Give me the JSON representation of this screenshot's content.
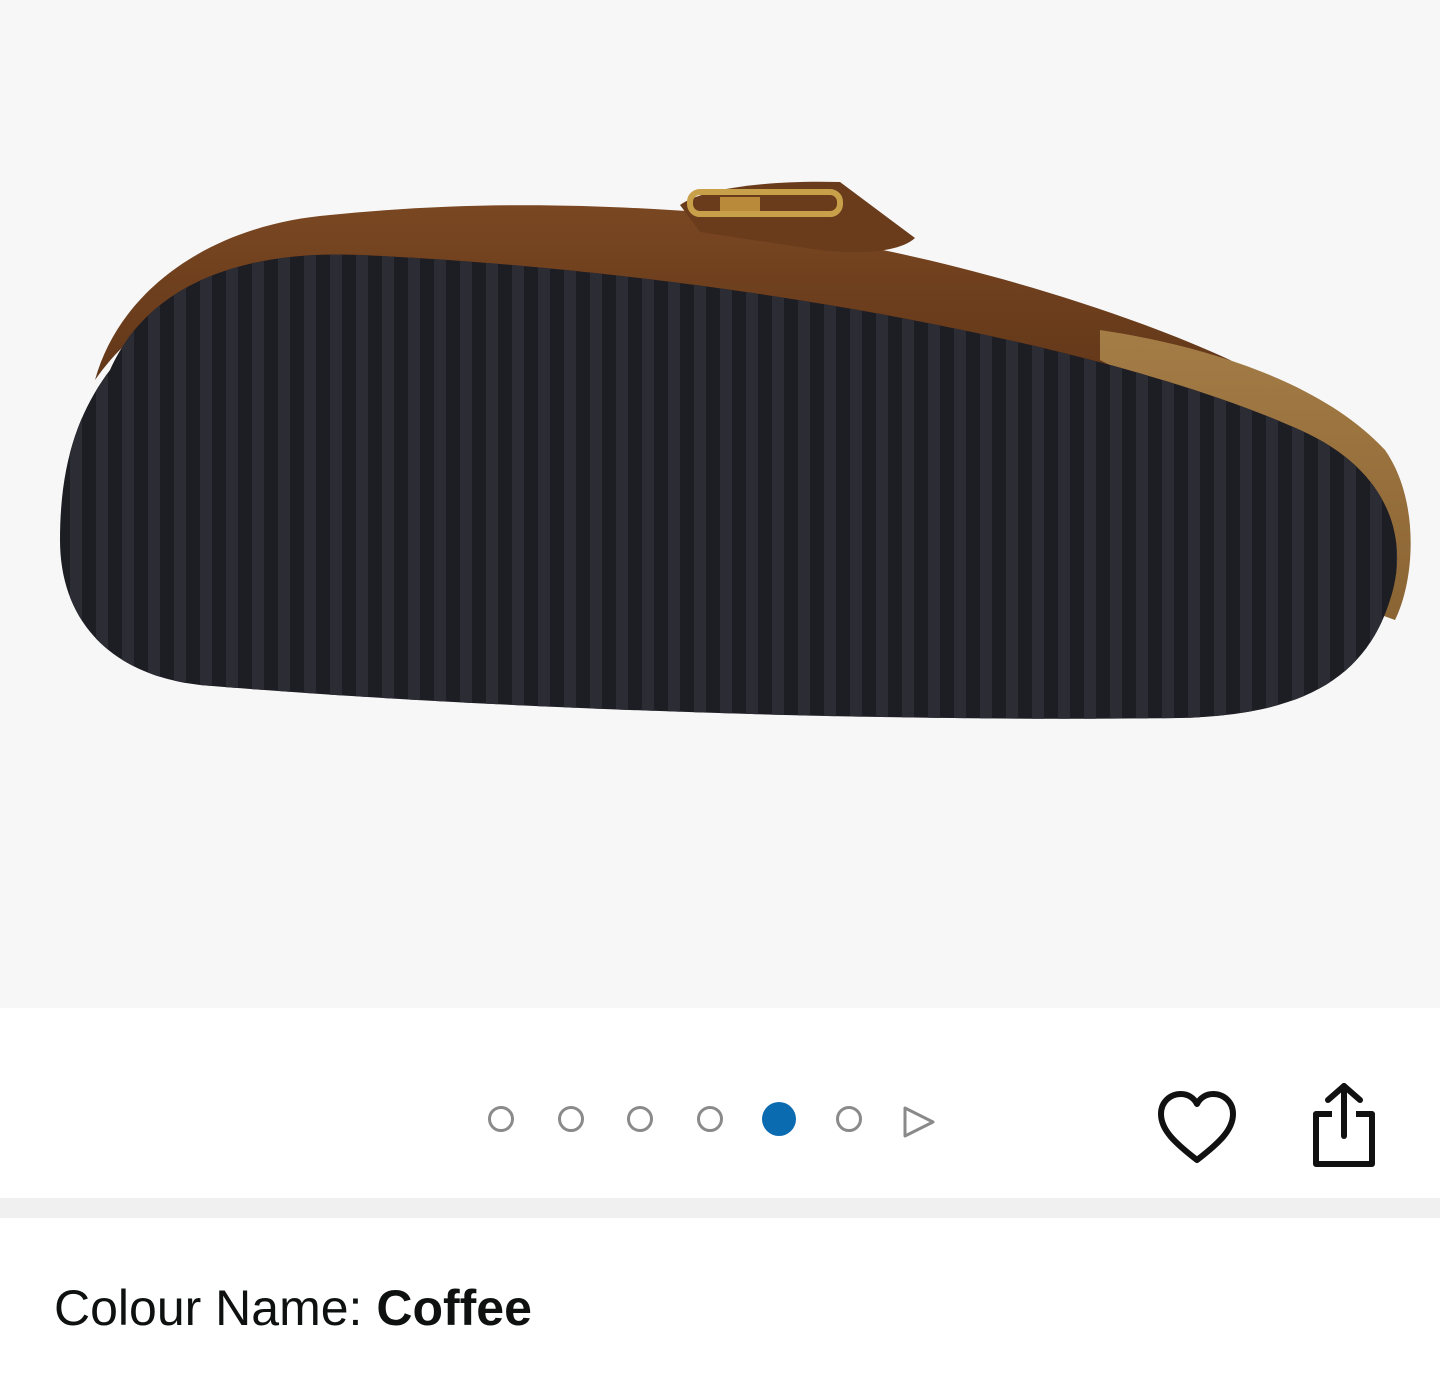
{
  "product": {
    "image_alt": "Coffee suede cork footbed sandal, outsole view",
    "colour_label": "Colour Name:",
    "colour_value": "Coffee"
  },
  "carousel": {
    "total_dots": 6,
    "active_index": 4,
    "has_next_arrow": true
  },
  "actions": {
    "wishlist_icon": "heart-icon",
    "share_icon": "share-icon"
  },
  "colors": {
    "accent": "#0b6bb0",
    "dot_inactive": "#8a8a8a",
    "sole": "#1c1c22",
    "suede": "#6b3f1d",
    "cork": "#9a7440"
  }
}
